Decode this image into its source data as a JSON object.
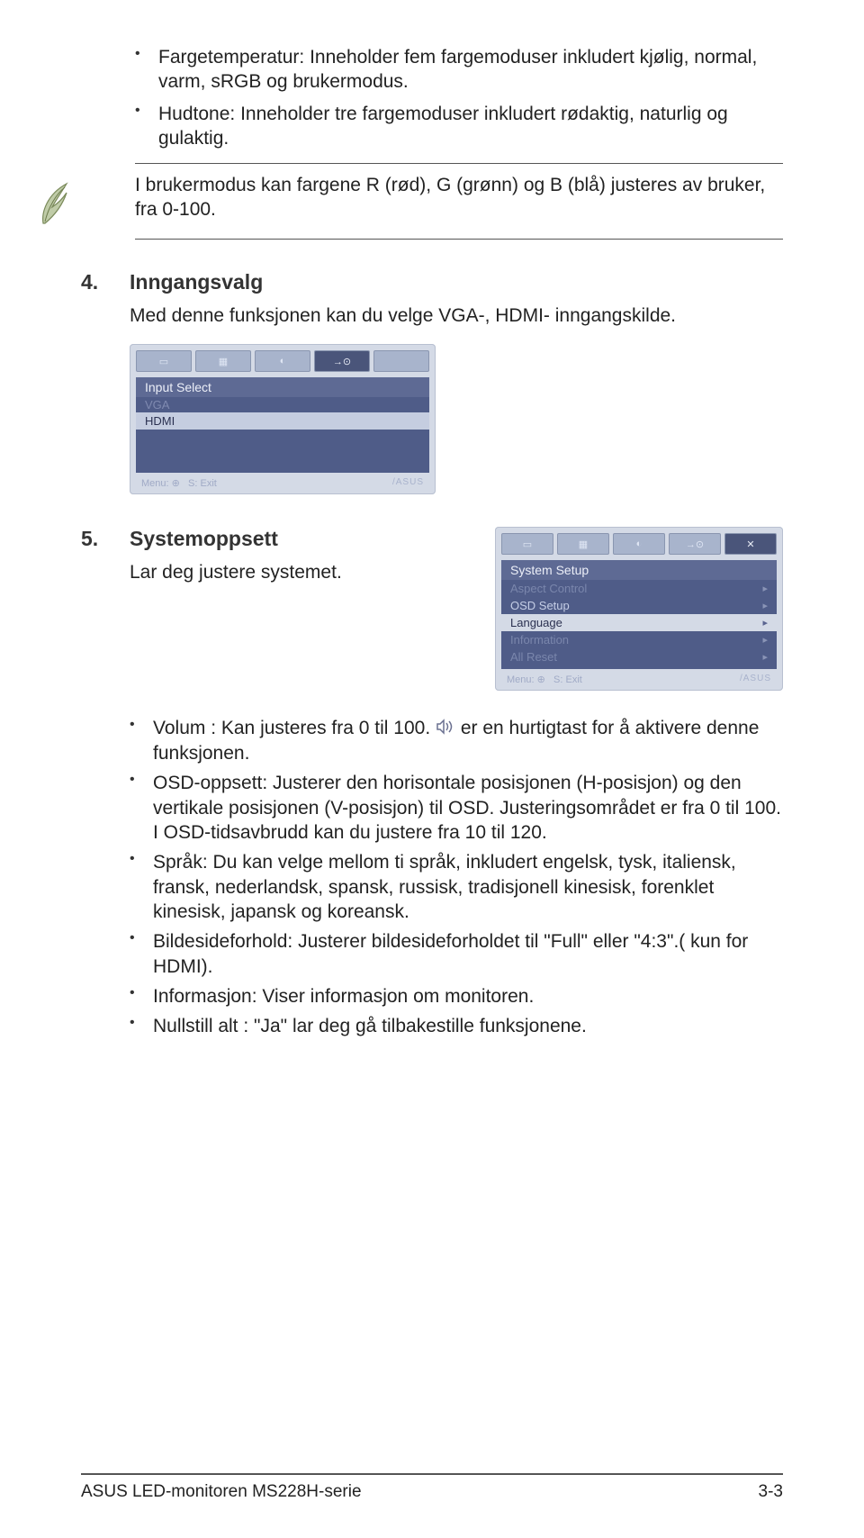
{
  "top_bullets": [
    "Fargetemperatur: Inneholder fem fargemoduser inkludert kjølig, normal, varm, sRGB og brukermodus.",
    "Hudtone: Inneholder tre fargemoduser inkludert rødaktig, naturlig og gulaktig."
  ],
  "note": "I brukermodus kan fargene R (rød), G (grønn) og B (blå) justeres av bruker, fra 0-100.",
  "section4": {
    "num": "4.",
    "title": "Inngangsvalg",
    "body": "Med denne funksjonen kan du velge VGA-, HDMI- inngangskilde."
  },
  "osd1": {
    "title": "Input Select",
    "vga": "VGA",
    "hdmi": "HDMI",
    "menu": "Menu: ⊕",
    "exit": "S: Exit",
    "brand": "/ASUS"
  },
  "section5": {
    "num": "5.",
    "title": "Systemoppsett",
    "body": "Lar deg justere systemet."
  },
  "osd2": {
    "title": "System Setup",
    "items": [
      "Aspect Control",
      "OSD Setup",
      "Language",
      "Information",
      "All Reset"
    ],
    "menu": "Menu: ⊕",
    "exit": "S: Exit",
    "brand": "/ASUS"
  },
  "lower_bullets_pre": "Volum : Kan justeres fra 0 til 100. ",
  "lower_bullets_post": " er en hurtigtast for å aktivere denne funksjonen.",
  "lower_bullets": [
    "OSD-oppsett: Justerer den horisontale posisjonen (H-posisjon) og den vertikale posisjonen (V-posisjon) til OSD. Justeringsområdet er fra 0 til 100. I OSD-tidsavbrudd kan du justere fra 10 til 120.",
    "Språk: Du kan velge mellom ti språk, inkludert engelsk, tysk, italiensk, fransk, nederlandsk, spansk, russisk, tradisjonell kinesisk, forenklet kinesisk, japansk og koreansk.",
    "Bildesideforhold: Justerer bildesideforholdet til \"Full\" eller \"4:3\".( kun for HDMI).",
    "Informasjon: Viser informasjon om monitoren.",
    "Nullstill alt : \"Ja\" lar deg gå tilbakestille funksjonene."
  ],
  "footer": {
    "left": "ASUS LED-monitoren MS228H-serie",
    "right": "3-3"
  }
}
